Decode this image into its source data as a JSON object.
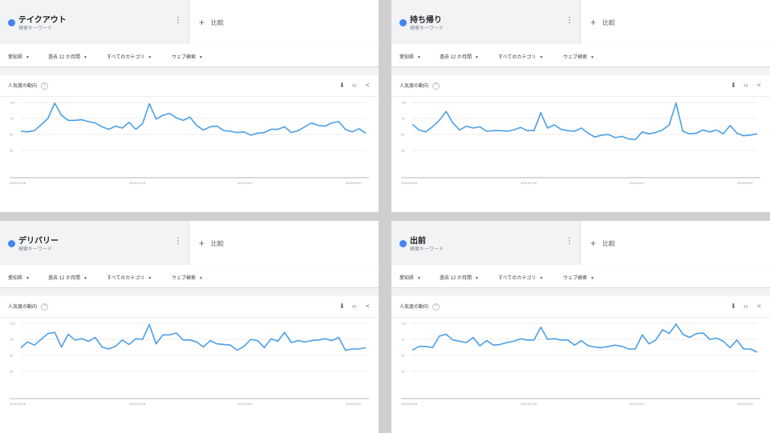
{
  "filters": {
    "region": "愛知県",
    "period": "過去 12 か月間",
    "category": "すべてのカテゴリ",
    "search_type": "ウェブ検索"
  },
  "compare_label": "比較",
  "card_title": "人気度の動向",
  "y_ticks": [
    "100",
    "75",
    "50",
    "25"
  ],
  "x_ticks": [
    "2021/03/28",
    "2021/07/18",
    "2021/11/07",
    "2022/02/27"
  ],
  "accent_color": "#4285f4",
  "line_color": "#4a9fe6",
  "panels": [
    {
      "term": "テイクアウト",
      "sub": "検索キーワード",
      "chart_data": {
        "type": "line",
        "ylim": [
          0,
          100
        ],
        "x_ticks": [
          "2021/03/28",
          "2021/07/18",
          "2021/11/07",
          "2022/02/27"
        ],
        "values": [
          55,
          54,
          56,
          65,
          75,
          99,
          80,
          72,
          72,
          73,
          70,
          68,
          62,
          58,
          63,
          60,
          69,
          58,
          67,
          98,
          74,
          80,
          83,
          76,
          72,
          77,
          64,
          57,
          62,
          63,
          56,
          55,
          53,
          54,
          49,
          52,
          53,
          58,
          58,
          62,
          53,
          56,
          62,
          68,
          64,
          63,
          68,
          70,
          58,
          54,
          59,
          52
        ]
      }
    },
    {
      "term": "持ち帰り",
      "sub": "検索キーワード",
      "chart_data": {
        "type": "line",
        "ylim": [
          0,
          100
        ],
        "x_ticks": [
          "2021/03/28",
          "2021/07/18",
          "2021/11/07",
          "2022/02/27"
        ],
        "values": [
          66,
          57,
          54,
          62,
          72,
          86,
          68,
          57,
          63,
          60,
          62,
          55,
          56,
          56,
          55,
          57,
          61,
          56,
          56,
          84,
          60,
          65,
          58,
          56,
          55,
          60,
          52,
          46,
          49,
          50,
          45,
          47,
          43,
          42,
          54,
          51,
          53,
          57,
          65,
          99,
          55,
          51,
          52,
          57,
          54,
          57,
          51,
          64,
          52,
          48,
          49,
          51
        ]
      }
    },
    {
      "term": "デリバリー",
      "sub": "検索キーワード",
      "chart_data": {
        "type": "line",
        "ylim": [
          0,
          100
        ],
        "x_ticks": [
          "2021/03/28",
          "2021/07/18",
          "2021/11/07",
          "2022/02/27"
        ],
        "values": [
          62,
          71,
          66,
          75,
          84,
          86,
          63,
          83,
          74,
          76,
          72,
          78,
          63,
          60,
          64,
          74,
          67,
          76,
          75,
          98,
          68,
          82,
          82,
          85,
          74,
          74,
          71,
          63,
          73,
          68,
          67,
          66,
          58,
          64,
          75,
          73,
          62,
          76,
          72,
          86,
          70,
          73,
          71,
          73,
          74,
          76,
          73,
          78,
          58,
          60,
          60,
          62
        ]
      }
    },
    {
      "term": "出前",
      "sub": "検索キーワード",
      "chart_data": {
        "type": "line",
        "ylim": [
          0,
          100
        ],
        "x_ticks": [
          "2021/03/28",
          "2021/07/18",
          "2021/11/07",
          "2022/02/27"
        ],
        "values": [
          58,
          64,
          64,
          62,
          80,
          83,
          74,
          72,
          70,
          78,
          65,
          73,
          66,
          67,
          70,
          72,
          76,
          74,
          74,
          94,
          75,
          76,
          74,
          74,
          66,
          73,
          65,
          63,
          62,
          64,
          66,
          64,
          60,
          60,
          82,
          68,
          74,
          90,
          84,
          99,
          83,
          78,
          84,
          85,
          75,
          77,
          72,
          62,
          74,
          60,
          60,
          55
        ]
      }
    }
  ]
}
